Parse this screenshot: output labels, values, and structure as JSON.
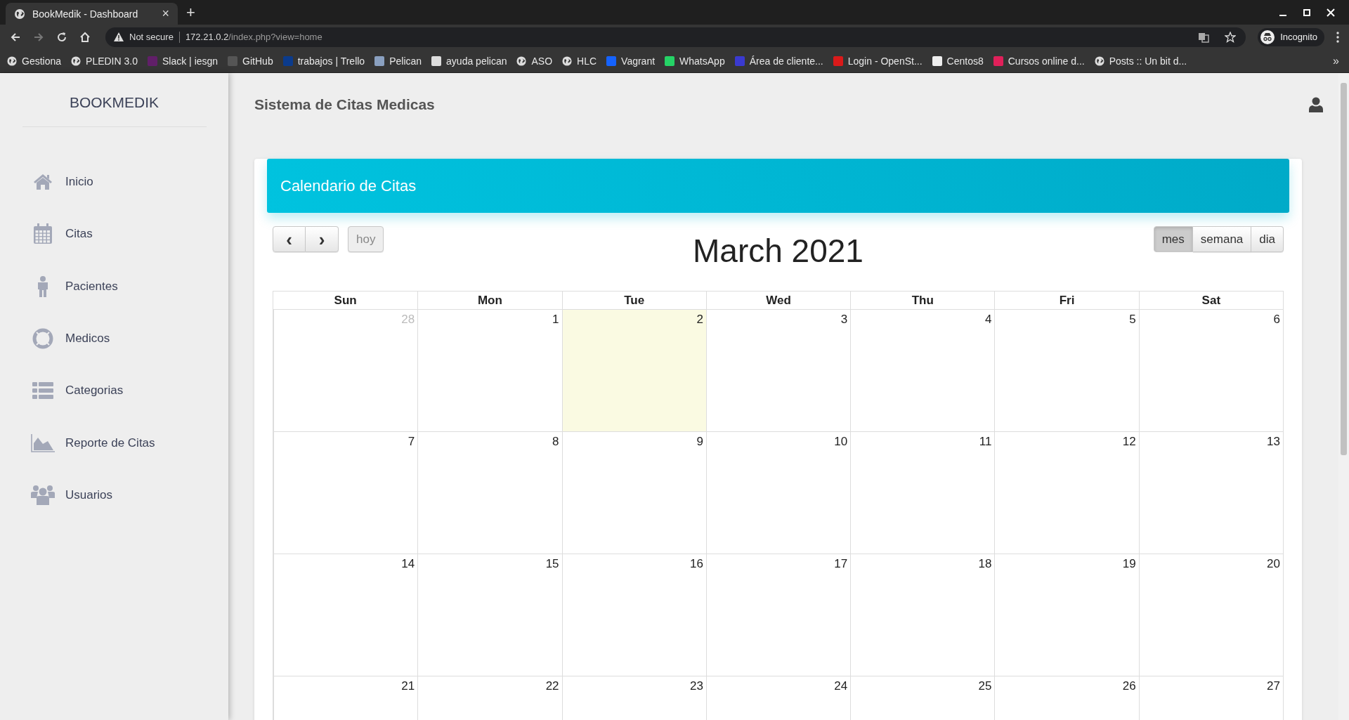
{
  "browser": {
    "tab": {
      "title": "BookMedik - Dashboard",
      "close": "×",
      "selected": true
    },
    "new_tab": "+",
    "address": {
      "security": "Not secure",
      "host": "172.21.0.2",
      "path": "/index.php?view=home"
    },
    "profile": "Incognito",
    "bookmarks": [
      {
        "label": "Gestiona",
        "kind": "globe"
      },
      {
        "label": "PLEDIN 3.0",
        "kind": "globe"
      },
      {
        "label": "Slack | iesgn",
        "kind": "favicon",
        "color": "#611f69"
      },
      {
        "label": "GitHub",
        "kind": "favicon",
        "color": "#555555"
      },
      {
        "label": "trabajos | Trello",
        "kind": "favicon",
        "color": "#0b3b8c"
      },
      {
        "label": "Pelican",
        "kind": "favicon",
        "color": "#8aa0c0"
      },
      {
        "label": "ayuda pelican",
        "kind": "favicon",
        "color": "#dddddd"
      },
      {
        "label": "ASO",
        "kind": "globe"
      },
      {
        "label": "HLC",
        "kind": "globe"
      },
      {
        "label": "Vagrant",
        "kind": "favicon",
        "color": "#1563ff"
      },
      {
        "label": "WhatsApp",
        "kind": "favicon",
        "color": "#25d366"
      },
      {
        "label": "Área de cliente...",
        "kind": "favicon",
        "color": "#3a3ad0"
      },
      {
        "label": "Login - OpenSt...",
        "kind": "favicon",
        "color": "#da1a1a"
      },
      {
        "label": "Centos8",
        "kind": "favicon",
        "color": "#eeeeee"
      },
      {
        "label": "Cursos online d...",
        "kind": "favicon",
        "color": "#e0205a"
      },
      {
        "label": "Posts :: Un bit d...",
        "kind": "globe"
      }
    ],
    "more": "»"
  },
  "sidebar": {
    "brand": "BOOKMEDIK",
    "items": [
      {
        "label": "Inicio",
        "kind": "home"
      },
      {
        "label": "Citas",
        "kind": "calendar"
      },
      {
        "label": "Pacientes",
        "kind": "person"
      },
      {
        "label": "Medicos",
        "kind": "lifebuoy"
      },
      {
        "label": "Categorias",
        "kind": "list"
      },
      {
        "label": "Reporte de Citas",
        "kind": "chart"
      },
      {
        "label": "Usuarios",
        "kind": "users"
      }
    ]
  },
  "header": {
    "title": "Sistema de Citas Medicas"
  },
  "card": {
    "title": "Calendario de Citas"
  },
  "calendar": {
    "prev": "‹",
    "next": "›",
    "today_button": "hoy",
    "title": "March 2021",
    "views": [
      {
        "label": "mes",
        "selected": true
      },
      {
        "label": "semana",
        "selected": false
      },
      {
        "label": "dia",
        "selected": false
      }
    ],
    "weekdays": [
      "Sun",
      "Mon",
      "Tue",
      "Wed",
      "Thu",
      "Fri",
      "Sat"
    ],
    "weeks": [
      [
        {
          "day": "28",
          "other_month": true,
          "today": false
        },
        {
          "day": "1",
          "other_month": false,
          "today": false
        },
        {
          "day": "2",
          "other_month": false,
          "today": true
        },
        {
          "day": "3",
          "other_month": false,
          "today": false
        },
        {
          "day": "4",
          "other_month": false,
          "today": false
        },
        {
          "day": "5",
          "other_month": false,
          "today": false
        },
        {
          "day": "6",
          "other_month": false,
          "today": false
        }
      ],
      [
        {
          "day": "7",
          "other_month": false,
          "today": false
        },
        {
          "day": "8",
          "other_month": false,
          "today": false
        },
        {
          "day": "9",
          "other_month": false,
          "today": false
        },
        {
          "day": "10",
          "other_month": false,
          "today": false
        },
        {
          "day": "11",
          "other_month": false,
          "today": false
        },
        {
          "day": "12",
          "other_month": false,
          "today": false
        },
        {
          "day": "13",
          "other_month": false,
          "today": false
        }
      ],
      [
        {
          "day": "14",
          "other_month": false,
          "today": false
        },
        {
          "day": "15",
          "other_month": false,
          "today": false
        },
        {
          "day": "16",
          "other_month": false,
          "today": false
        },
        {
          "day": "17",
          "other_month": false,
          "today": false
        },
        {
          "day": "18",
          "other_month": false,
          "today": false
        },
        {
          "day": "19",
          "other_month": false,
          "today": false
        },
        {
          "day": "20",
          "other_month": false,
          "today": false
        }
      ],
      [
        {
          "day": "21",
          "other_month": false,
          "today": false
        },
        {
          "day": "22",
          "other_month": false,
          "today": false
        },
        {
          "day": "23",
          "other_month": false,
          "today": false
        },
        {
          "day": "24",
          "other_month": false,
          "today": false
        },
        {
          "day": "25",
          "other_month": false,
          "today": false
        },
        {
          "day": "26",
          "other_month": false,
          "today": false
        },
        {
          "day": "27",
          "other_month": false,
          "today": false
        }
      ]
    ]
  }
}
